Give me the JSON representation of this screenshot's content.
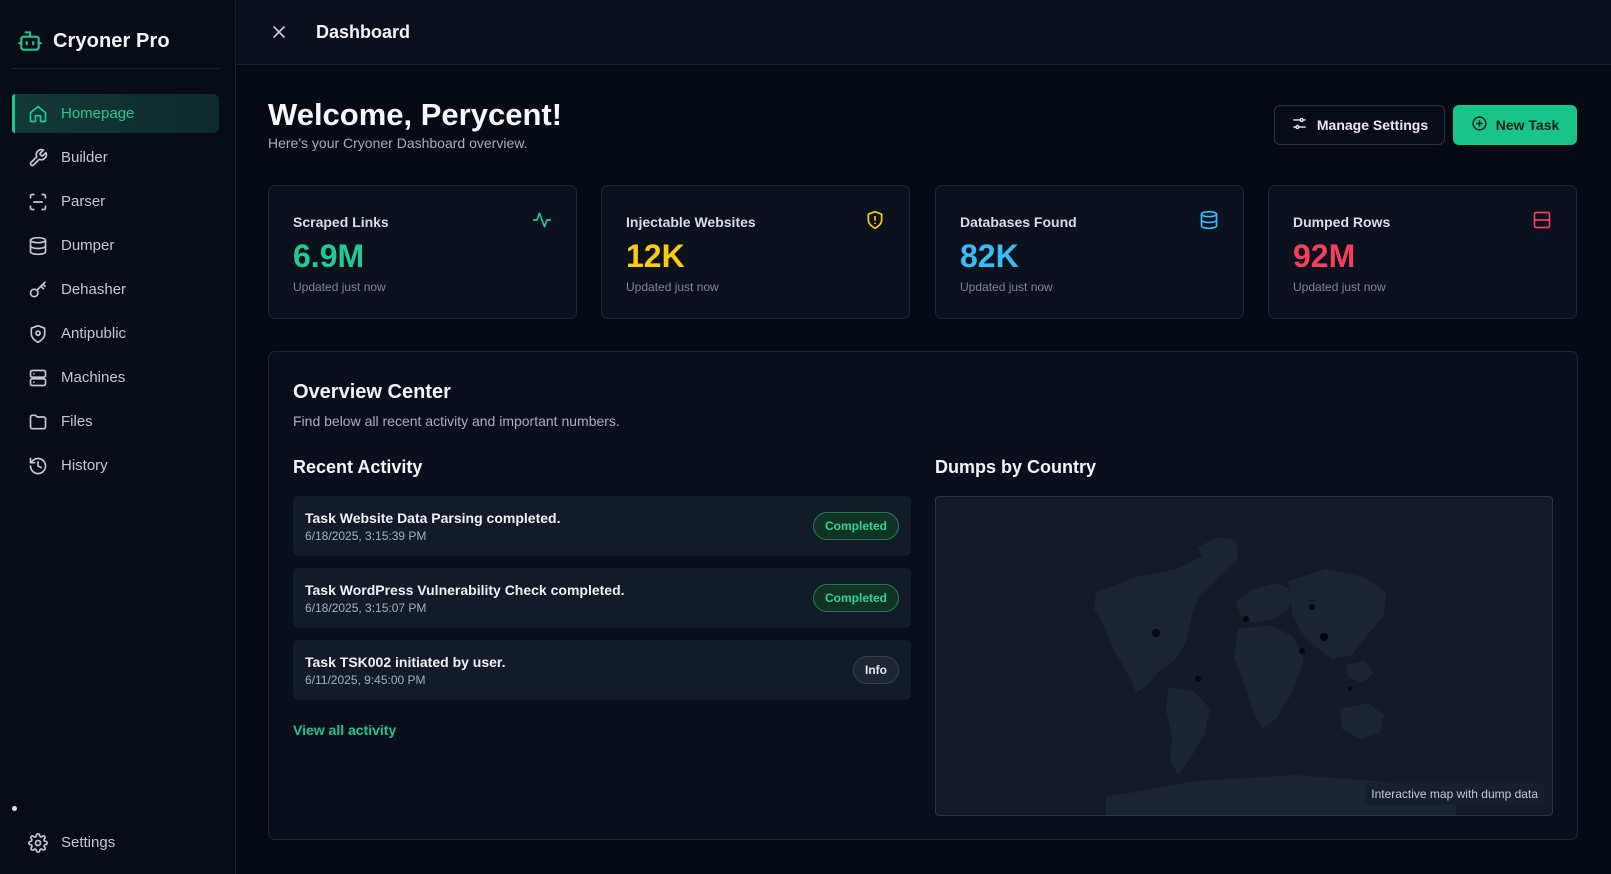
{
  "app": {
    "name": "Cryoner Pro"
  },
  "sidebar": {
    "items": [
      {
        "label": "Homepage",
        "icon": "home-icon",
        "active": true
      },
      {
        "label": "Builder",
        "icon": "wrench-icon"
      },
      {
        "label": "Parser",
        "icon": "scan-icon"
      },
      {
        "label": "Dumper",
        "icon": "database-icon"
      },
      {
        "label": "Dehasher",
        "icon": "key-icon"
      },
      {
        "label": "Antipublic",
        "icon": "shield-icon"
      },
      {
        "label": "Machines",
        "icon": "server-icon"
      },
      {
        "label": "Files",
        "icon": "folder-icon"
      },
      {
        "label": "History",
        "icon": "history-icon"
      }
    ],
    "settings_label": "Settings"
  },
  "topbar": {
    "title": "Dashboard"
  },
  "header": {
    "welcome": "Welcome, Perycent!",
    "subtitle": "Here's your Cryoner Dashboard overview.",
    "manage_settings_label": "Manage Settings",
    "new_task_label": "New Task"
  },
  "stats": [
    {
      "label": "Scraped Links",
      "value": "6.9M",
      "updated": "Updated just now",
      "color": "#22c993",
      "icon": "activity-icon"
    },
    {
      "label": "Injectable Websites",
      "value": "12K",
      "updated": "Updated just now",
      "color": "#facc15",
      "icon": "shield-alert-icon"
    },
    {
      "label": "Databases Found",
      "value": "82K",
      "updated": "Updated just now",
      "color": "#38bdf8",
      "icon": "database-icon"
    },
    {
      "label": "Dumped Rows",
      "value": "92M",
      "updated": "Updated just now",
      "color": "#f43f5e",
      "icon": "table-rows-icon"
    }
  ],
  "overview": {
    "title": "Overview Center",
    "subtitle": "Find below all recent activity and important numbers.",
    "recent_title": "Recent Activity",
    "activities": [
      {
        "title": "Task Website Data Parsing completed.",
        "time": "6/18/2025, 3:15:39 PM",
        "status": "Completed"
      },
      {
        "title": "Task WordPress Vulnerability Check completed.",
        "time": "6/18/2025, 3:15:07 PM",
        "status": "Completed"
      },
      {
        "title": "Task TSK002 initiated by user.",
        "time": "6/11/2025, 9:45:00 PM",
        "status": "Info"
      }
    ],
    "view_all_label": "View all activity",
    "map_title": "Dumps by Country",
    "map_caption": "Interactive map with dump data"
  }
}
